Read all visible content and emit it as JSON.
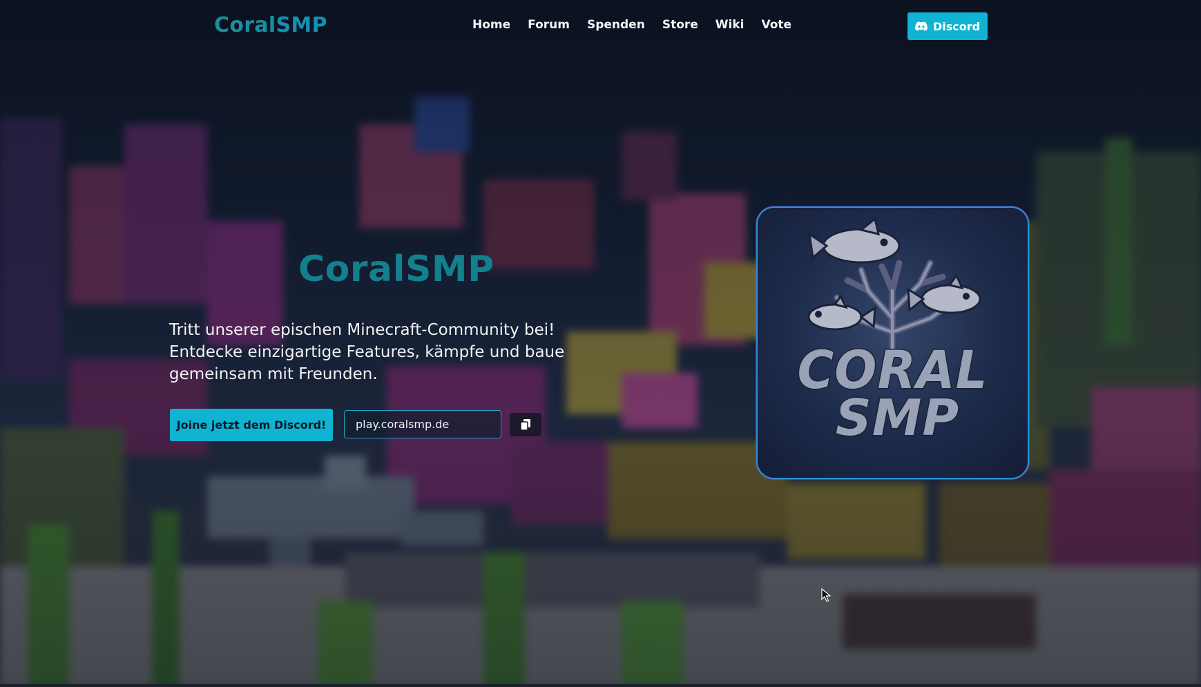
{
  "nav": {
    "brand_part1": "Coral",
    "brand_part2": "SMP",
    "links": [
      {
        "label": "Home"
      },
      {
        "label": "Forum"
      },
      {
        "label": "Spenden"
      },
      {
        "label": "Store"
      },
      {
        "label": "Wiki"
      },
      {
        "label": "Vote"
      }
    ],
    "discord_label": "Discord",
    "discord_icon": "discord-icon"
  },
  "hero": {
    "title_part1": "Coral",
    "title_part2": "SMP",
    "description": "Tritt unserer epischen Minecraft-Community bei! Entdecke einzigartige Features, kämpfe und baue gemeinsam mit Freunden.",
    "join_button_label": "Joine jetzt dem Discord!",
    "server_ip_value": "play.coralsmp.de",
    "copy_icon": "copy-icon"
  },
  "logo": {
    "line1": "CORAL",
    "line2": "SMP"
  },
  "colors": {
    "accent": "#10b3d2",
    "brand_teal": "#13808e",
    "text_light": "#f1f3f6"
  }
}
